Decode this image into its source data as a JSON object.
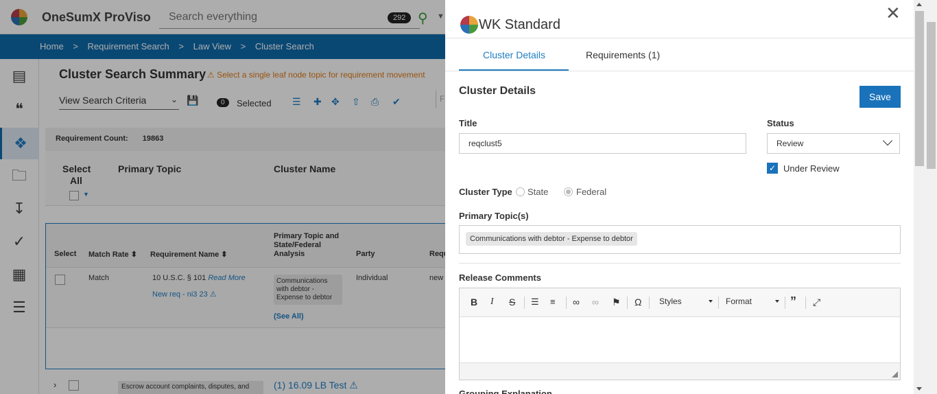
{
  "app": {
    "name": "OneSumX ProViso",
    "search_placeholder": "Search everything",
    "search_count": "292"
  },
  "breadcrumb": [
    "Home",
    ">",
    "Requirement Search",
    ">",
    "Law View",
    ">",
    "Cluster Search"
  ],
  "summary": {
    "title": "Cluster Search Summary",
    "warning": "⚠ Select a single leaf node topic for requirement movement",
    "criteria": "View Search Criteria",
    "selected_count": "0",
    "selected_label": "Selected",
    "filter_stub": "Fi",
    "req_count_label": "Requirement Count:",
    "req_count_value": "19863"
  },
  "table": {
    "select_all": "Select All",
    "primary_topic": "Primary Topic",
    "cluster_name": "Cluster Name",
    "sub_headers": {
      "select": "Select",
      "match_rate": "Match Rate ⬍",
      "req_name": "Requirement Name ⬍",
      "analysis": "Primary Topic and State/Federal Analysis",
      "party": "Party",
      "req_stub": "Requ"
    },
    "row": {
      "match": "Match",
      "req_name": "10 U.S.C. § 101",
      "read_more": "Read More",
      "new_req": "New req - ni3 23 ⚠",
      "topic": "Communications with debtor - Expense to debtor",
      "see_all": "(See All)",
      "party": "Individual",
      "req_stub": "new"
    },
    "row2": {
      "topic": "Escrow account complaints, disputes, and",
      "cluster": "(1) 16.09 LB Test ⚠"
    }
  },
  "panel": {
    "title": "WK Standard",
    "tabs": {
      "cluster_details": "Cluster Details",
      "requirements": "Requirements (1)"
    },
    "section_title": "Cluster Details",
    "save": "Save",
    "title_label": "Title",
    "title_value": "reqclust5",
    "status_label": "Status",
    "status_value": "Review",
    "under_review": "Under Review",
    "cluster_type_label": "Cluster Type",
    "cluster_type_state": "State",
    "cluster_type_federal": "Federal",
    "primary_topics_label": "Primary Topic(s)",
    "primary_topic_chip": "Communications with debtor - Expense to debtor",
    "release_comments_label": "Release Comments",
    "editor": {
      "styles": "Styles",
      "format": "Format"
    },
    "grouping_label": "Grouping Explanation"
  }
}
